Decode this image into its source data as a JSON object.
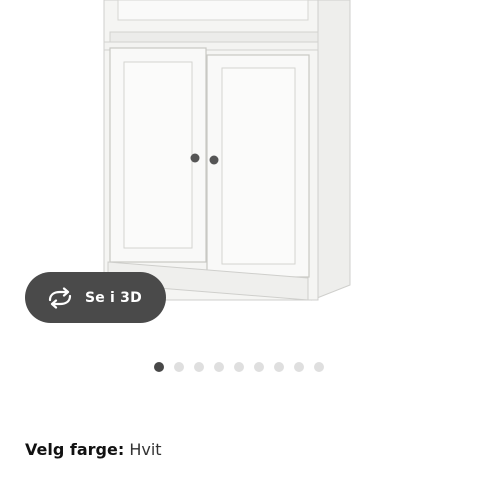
{
  "product": {
    "image_icon": "cabinet-product-image"
  },
  "viewer": {
    "view_3d_label": "Se i 3D",
    "view_3d_icon": "rotate-icon"
  },
  "carousel": {
    "total": 9,
    "active_index": 0
  },
  "color": {
    "label": "Velg farge:",
    "value": "Hvit"
  },
  "colors": {
    "button_bg": "#4a4a4a",
    "dot_active": "#484848",
    "dot_inactive": "#dfdfdf"
  }
}
